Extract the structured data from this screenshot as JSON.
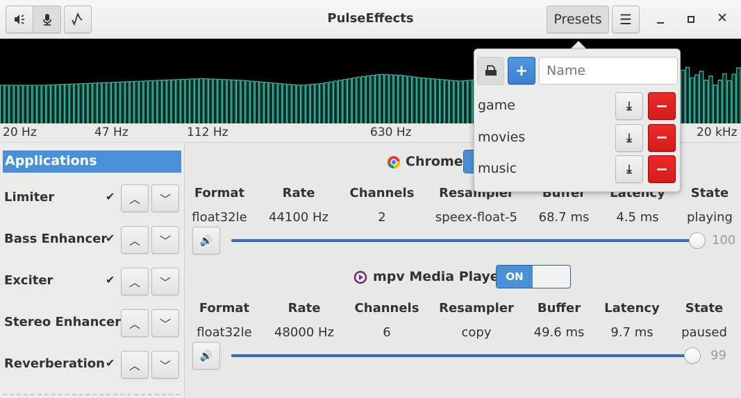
{
  "window": {
    "title": "PulseEffects",
    "presets_label": "Presets"
  },
  "header_icons": [
    "speaker-icon",
    "microphone-icon",
    "waveform-icon",
    "menu-icon",
    "minimize-icon",
    "maximize-icon",
    "close-icon"
  ],
  "chart_data": {
    "type": "bar",
    "title": "Spectrum",
    "x_tick_labels": [
      "20 Hz",
      "47 Hz",
      "112 Hz",
      "630 Hz",
      "20 kHz"
    ],
    "bar_count": 160,
    "levels_control": [
      0.45,
      0.45,
      0.45,
      0.46,
      0.47,
      0.48,
      0.49,
      0.5,
      0.51,
      0.52,
      0.53,
      0.52,
      0.51,
      0.49,
      0.47,
      0.45,
      0.47,
      0.51,
      0.55,
      0.58,
      0.57,
      0.54,
      0.52,
      0.5,
      0.52,
      0.55,
      0.5,
      0.53,
      0.56,
      0.58,
      0.6,
      0.62,
      0.66,
      0.62,
      0.65,
      0.55,
      0.52,
      0.6
    ],
    "ylim": [
      0,
      1
    ],
    "color": "#3cc0a8"
  },
  "sidebar": {
    "selected": "Applications",
    "items": [
      {
        "label": "Applications"
      },
      {
        "label": "Limiter",
        "enabled": true
      },
      {
        "label": "Bass Enhancer",
        "enabled": true
      },
      {
        "label": "Exciter",
        "enabled": true
      },
      {
        "label": "Stereo Enhancer",
        "enabled": false
      },
      {
        "label": "Reverberation",
        "enabled": true
      }
    ],
    "check": "✔"
  },
  "apps": [
    {
      "name": "Chrome",
      "switch": "ON",
      "headers": [
        "Format",
        "Rate",
        "Channels",
        "Resampler",
        "Buffer",
        "Latency",
        "State"
      ],
      "values": [
        "float32le",
        "44100 Hz",
        "2",
        "speex-float-5",
        "68.7 ms",
        "4.5 ms",
        "playing"
      ],
      "volume": 100
    },
    {
      "name": "mpv Media Player",
      "switch": "ON",
      "headers": [
        "Format",
        "Rate",
        "Channels",
        "Resampler",
        "Buffer",
        "Latency",
        "State"
      ],
      "values": [
        "float32le",
        "48000 Hz",
        "6",
        "copy",
        "49.6 ms",
        "9.7 ms",
        "paused"
      ],
      "volume": 99
    }
  ],
  "presets": {
    "name_placeholder": "Name",
    "items": [
      "game",
      "movies",
      "music"
    ]
  },
  "colors": {
    "accent": "#4a90d9",
    "destructive": "#e01b1b",
    "spectrum": "#3cc0a8"
  }
}
